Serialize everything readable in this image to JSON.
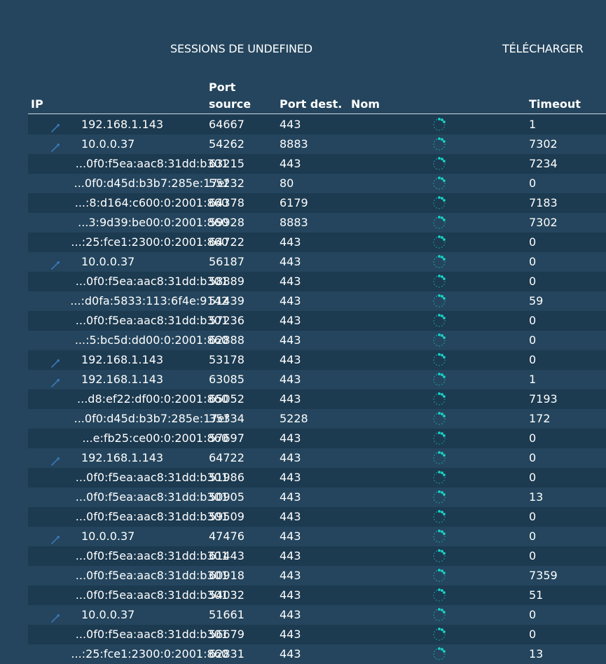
{
  "header": {
    "title": "SESSIONS DE UNDEFINED",
    "download_label": "TÉLÉCHARGER"
  },
  "columns": {
    "ip": "IP",
    "source_port_line1": "Port",
    "source_port_line2": "source",
    "dest_port": "Port dest.",
    "name": "Nom",
    "timeout": "Timeout"
  },
  "icons": {
    "local_ip": "pin-icon",
    "loading": "loading-spinner-icon"
  },
  "colors": {
    "background": "#24455d",
    "row_alt": "#1c3a50",
    "spinner": "#19d3c5",
    "pin": "#3a78b8"
  },
  "sessions": [
    {
      "ip": "192.168.1.143",
      "sport": "64667",
      "dport": "443",
      "timeout": "1",
      "local": true
    },
    {
      "ip": "10.0.0.37",
      "sport": "54262",
      "dport": "8883",
      "timeout": "7302",
      "local": true
    },
    {
      "ip": "...0f0:f5ea:aac8:31dd:b301",
      "sport": "63215",
      "dport": "443",
      "timeout": "7234",
      "local": false
    },
    {
      "ip": "...0f0:d45d:b3b7:285e:17ef",
      "sport": "55232",
      "dport": "80",
      "timeout": "0",
      "local": false
    },
    {
      "ip": "...:8:d164:c600:0:2001:860",
      "sport": "64378",
      "dport": "6179",
      "timeout": "7183",
      "local": false
    },
    {
      "ip": "...3:9d39:be00:0:2001:860",
      "sport": "59928",
      "dport": "8883",
      "timeout": "7302",
      "local": false
    },
    {
      "ip": "...:25:fce1:2300:0:2001:860",
      "sport": "64722",
      "dport": "443",
      "timeout": "0",
      "local": false
    },
    {
      "ip": "10.0.0.37",
      "sport": "56187",
      "dport": "443",
      "timeout": "0",
      "local": true
    },
    {
      "ip": "...0f0:f5ea:aac8:31dd:b301",
      "sport": "58889",
      "dport": "443",
      "timeout": "0",
      "local": false
    },
    {
      "ip": "...:d0fa:5833:113:6f4e:9142",
      "sport": "51439",
      "dport": "443",
      "timeout": "59",
      "local": false
    },
    {
      "ip": "...0f0:f5ea:aac8:31dd:b301",
      "sport": "57236",
      "dport": "443",
      "timeout": "0",
      "local": false
    },
    {
      "ip": "...:5:bc5d:dd00:0:2001:860",
      "sport": "62888",
      "dport": "443",
      "timeout": "0",
      "local": false
    },
    {
      "ip": "192.168.1.143",
      "sport": "53178",
      "dport": "443",
      "timeout": "0",
      "local": true
    },
    {
      "ip": "192.168.1.143",
      "sport": "63085",
      "dport": "443",
      "timeout": "1",
      "local": true
    },
    {
      "ip": "...d8:ef22:df00:0:2001:860",
      "sport": "65052",
      "dport": "443",
      "timeout": "7193",
      "local": false
    },
    {
      "ip": "...0f0:d45d:b3b7:285e:17ef",
      "sport": "35334",
      "dport": "5228",
      "timeout": "172",
      "local": false
    },
    {
      "ip": "...e:fb25:ce00:0:2001:860",
      "sport": "57697",
      "dport": "443",
      "timeout": "0",
      "local": false
    },
    {
      "ip": "192.168.1.143",
      "sport": "64722",
      "dport": "443",
      "timeout": "0",
      "local": true
    },
    {
      "ip": "...0f0:f5ea:aac8:31dd:b301",
      "sport": "51986",
      "dport": "443",
      "timeout": "0",
      "local": false
    },
    {
      "ip": "...0f0:f5ea:aac8:31dd:b301",
      "sport": "50905",
      "dport": "443",
      "timeout": "13",
      "local": false
    },
    {
      "ip": "...0f0:f5ea:aac8:31dd:b301",
      "sport": "59509",
      "dport": "443",
      "timeout": "0",
      "local": false
    },
    {
      "ip": "10.0.0.37",
      "sport": "47476",
      "dport": "443",
      "timeout": "0",
      "local": true
    },
    {
      "ip": "...0f0:f5ea:aac8:31dd:b301",
      "sport": "61443",
      "dport": "443",
      "timeout": "0",
      "local": false
    },
    {
      "ip": "...0f0:f5ea:aac8:31dd:b301",
      "sport": "60918",
      "dport": "443",
      "timeout": "7359",
      "local": false
    },
    {
      "ip": "...0f0:f5ea:aac8:31dd:b301",
      "sport": "54032",
      "dport": "443",
      "timeout": "51",
      "local": false
    },
    {
      "ip": "10.0.0.37",
      "sport": "51661",
      "dport": "443",
      "timeout": "0",
      "local": true
    },
    {
      "ip": "...0f0:f5ea:aac8:31dd:b301",
      "sport": "56679",
      "dport": "443",
      "timeout": "0",
      "local": false
    },
    {
      "ip": "...:25:fce1:2300:0:2001:860",
      "sport": "62831",
      "dport": "443",
      "timeout": "13",
      "local": false
    }
  ]
}
